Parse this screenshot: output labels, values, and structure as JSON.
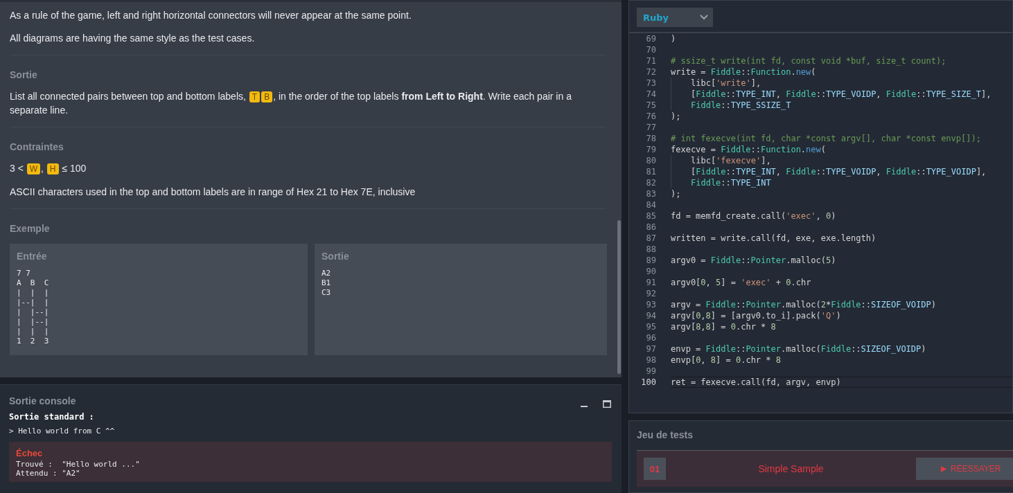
{
  "statement": {
    "intro": [
      [
        {
          "kind": "text",
          "text": "As a rule of the game, left and right horizontal connectors will never appear at the same point."
        }
      ],
      [
        {
          "kind": "text",
          "text": "All diagrams are having the same style as the test cases."
        }
      ]
    ],
    "sections": [
      {
        "heading": "Sortie",
        "paragraphs": [
          [
            {
              "kind": "text",
              "text": "List all connected pairs between top and bottom labels, "
            },
            {
              "kind": "var",
              "text": "T"
            },
            {
              "kind": "var",
              "text": "B"
            },
            {
              "kind": "text",
              "text": ", in the order of the top labels **from Left to Right**. Write each pair in a separate line."
            }
          ]
        ]
      },
      {
        "heading": "Contraintes",
        "paragraphs": [
          [
            {
              "kind": "text",
              "text": "3 < "
            },
            {
              "kind": "var",
              "text": "W"
            },
            {
              "kind": "text",
              "text": ", "
            },
            {
              "kind": "var",
              "text": "H"
            },
            {
              "kind": "text",
              "text": " ≤ 100"
            }
          ],
          [
            {
              "kind": "text",
              "text": "ASCII characters used in the top and bottom labels are in range of Hex 21 to Hex 7E, inclusive"
            }
          ]
        ]
      },
      {
        "heading": "Exemple",
        "example": {
          "input": {
            "heading": "Entrée",
            "lines": [
              "7 7",
              "A  B  C",
              "|  |  |",
              "|--|  |",
              "|  |--|",
              "|  |--|",
              "|  |  |",
              "1  2  3"
            ]
          },
          "output": {
            "heading": "Sortie",
            "lines": [
              "A2",
              "B1",
              "C3"
            ]
          }
        }
      }
    ]
  },
  "console": {
    "title": "Sortie console",
    "stdout_label": "Sortie standard :",
    "stdout_lines": [
      "> Hello world from C ^^"
    ],
    "failure": {
      "title": "Échec",
      "lines": [
        "Trouvé :  \"Hello world ...\"",
        "Attendu : \"A2\""
      ]
    }
  },
  "editor": {
    "language": "Ruby",
    "lines": [
      {
        "n": "69",
        "current": false,
        "indented": false,
        "tokens": [
          {
            "kind": "plain",
            "text": ")"
          }
        ]
      },
      {
        "n": "70",
        "current": false
      },
      {
        "n": "71",
        "current": false,
        "indented": false,
        "tokens": [
          {
            "kind": "comment",
            "text": "# ssize_t write(int fd, const void *buf, size_t count);"
          }
        ]
      },
      {
        "n": "72",
        "current": false,
        "indented": false,
        "tokens": [
          {
            "kind": "plain",
            "text": "write = "
          },
          {
            "kind": "class",
            "text": "Fiddle"
          },
          {
            "kind": "plain",
            "text": "::"
          },
          {
            "kind": "class",
            "text": "Function"
          },
          {
            "kind": "plain",
            "text": "."
          },
          {
            "kind": "method",
            "text": "new"
          },
          {
            "kind": "plain",
            "text": "("
          }
        ]
      },
      {
        "n": "73",
        "current": false,
        "indented": true,
        "tokens": [
          {
            "kind": "plain",
            "text": "libc["
          },
          {
            "kind": "string",
            "text": "'write'"
          },
          {
            "kind": "plain",
            "text": "],"
          }
        ]
      },
      {
        "n": "74",
        "current": false,
        "indented": true,
        "tokens": [
          {
            "kind": "plain",
            "text": "["
          },
          {
            "kind": "class",
            "text": "Fiddle"
          },
          {
            "kind": "plain",
            "text": "::"
          },
          {
            "kind": "constant",
            "text": "TYPE_INT"
          },
          {
            "kind": "plain",
            "text": ", "
          },
          {
            "kind": "class",
            "text": "Fiddle"
          },
          {
            "kind": "plain",
            "text": "::"
          },
          {
            "kind": "constant",
            "text": "TYPE_VOIDP"
          },
          {
            "kind": "plain",
            "text": ", "
          },
          {
            "kind": "class",
            "text": "Fiddle"
          },
          {
            "kind": "plain",
            "text": "::"
          },
          {
            "kind": "constant",
            "text": "TYPE_SIZE_T"
          },
          {
            "kind": "plain",
            "text": "],"
          }
        ]
      },
      {
        "n": "75",
        "current": false,
        "indented": true,
        "tokens": [
          {
            "kind": "class",
            "text": "Fiddle"
          },
          {
            "kind": "plain",
            "text": "::"
          },
          {
            "kind": "constant",
            "text": "TYPE_SSIZE_T"
          }
        ]
      },
      {
        "n": "76",
        "current": false,
        "indented": false,
        "tokens": [
          {
            "kind": "plain",
            "text": ");"
          }
        ]
      },
      {
        "n": "77",
        "current": false
      },
      {
        "n": "78",
        "current": false,
        "indented": false,
        "tokens": [
          {
            "kind": "comment",
            "text": "# int fexecve(int fd, char *const argv[], char *const envp[]);"
          }
        ]
      },
      {
        "n": "79",
        "current": false,
        "indented": false,
        "tokens": [
          {
            "kind": "plain",
            "text": "fexecve = "
          },
          {
            "kind": "class",
            "text": "Fiddle"
          },
          {
            "kind": "plain",
            "text": "::"
          },
          {
            "kind": "class",
            "text": "Function"
          },
          {
            "kind": "plain",
            "text": "."
          },
          {
            "kind": "method",
            "text": "new"
          },
          {
            "kind": "plain",
            "text": "("
          }
        ]
      },
      {
        "n": "80",
        "current": false,
        "indented": true,
        "tokens": [
          {
            "kind": "plain",
            "text": "libc["
          },
          {
            "kind": "string",
            "text": "'fexecve'"
          },
          {
            "kind": "plain",
            "text": "],"
          }
        ]
      },
      {
        "n": "81",
        "current": false,
        "indented": true,
        "tokens": [
          {
            "kind": "plain",
            "text": "["
          },
          {
            "kind": "class",
            "text": "Fiddle"
          },
          {
            "kind": "plain",
            "text": "::"
          },
          {
            "kind": "constant",
            "text": "TYPE_INT"
          },
          {
            "kind": "plain",
            "text": ", "
          },
          {
            "kind": "class",
            "text": "Fiddle"
          },
          {
            "kind": "plain",
            "text": "::"
          },
          {
            "kind": "constant",
            "text": "TYPE_VOIDP"
          },
          {
            "kind": "plain",
            "text": ", "
          },
          {
            "kind": "class",
            "text": "Fiddle"
          },
          {
            "kind": "plain",
            "text": "::"
          },
          {
            "kind": "constant",
            "text": "TYPE_VOIDP"
          },
          {
            "kind": "plain",
            "text": "],"
          }
        ]
      },
      {
        "n": "82",
        "current": false,
        "indented": true,
        "tokens": [
          {
            "kind": "class",
            "text": "Fiddle"
          },
          {
            "kind": "plain",
            "text": "::"
          },
          {
            "kind": "constant",
            "text": "TYPE_INT"
          }
        ]
      },
      {
        "n": "83",
        "current": false,
        "indented": false,
        "tokens": [
          {
            "kind": "plain",
            "text": ");"
          }
        ]
      },
      {
        "n": "84",
        "current": false
      },
      {
        "n": "85",
        "current": false,
        "indented": false,
        "tokens": [
          {
            "kind": "plain",
            "text": "fd = memfd_create.call("
          },
          {
            "kind": "string",
            "text": "'exec'"
          },
          {
            "kind": "plain",
            "text": ", "
          },
          {
            "kind": "number",
            "text": "0"
          },
          {
            "kind": "plain",
            "text": ")"
          }
        ]
      },
      {
        "n": "86",
        "current": false
      },
      {
        "n": "87",
        "current": false,
        "indented": false,
        "tokens": [
          {
            "kind": "plain",
            "text": "written = write.call(fd, exe, exe.length)"
          }
        ]
      },
      {
        "n": "88",
        "current": false
      },
      {
        "n": "89",
        "current": false,
        "indented": false,
        "tokens": [
          {
            "kind": "plain",
            "text": "argv0 = "
          },
          {
            "kind": "class",
            "text": "Fiddle"
          },
          {
            "kind": "plain",
            "text": "::"
          },
          {
            "kind": "class",
            "text": "Pointer"
          },
          {
            "kind": "plain",
            "text": ".malloc("
          },
          {
            "kind": "number",
            "text": "5"
          },
          {
            "kind": "plain",
            "text": ")"
          }
        ]
      },
      {
        "n": "90",
        "current": false
      },
      {
        "n": "91",
        "current": false,
        "indented": false,
        "tokens": [
          {
            "kind": "plain",
            "text": "argv0["
          },
          {
            "kind": "number",
            "text": "0"
          },
          {
            "kind": "plain",
            "text": ", "
          },
          {
            "kind": "number",
            "text": "5"
          },
          {
            "kind": "plain",
            "text": "] = "
          },
          {
            "kind": "string",
            "text": "'exec'"
          },
          {
            "kind": "plain",
            "text": " + "
          },
          {
            "kind": "number",
            "text": "0"
          },
          {
            "kind": "plain",
            "text": ".chr"
          }
        ]
      },
      {
        "n": "92",
        "current": false
      },
      {
        "n": "93",
        "current": false,
        "indented": false,
        "tokens": [
          {
            "kind": "plain",
            "text": "argv = "
          },
          {
            "kind": "class",
            "text": "Fiddle"
          },
          {
            "kind": "plain",
            "text": "::"
          },
          {
            "kind": "class",
            "text": "Pointer"
          },
          {
            "kind": "plain",
            "text": ".malloc("
          },
          {
            "kind": "number",
            "text": "2"
          },
          {
            "kind": "plain",
            "text": "*"
          },
          {
            "kind": "class",
            "text": "Fiddle"
          },
          {
            "kind": "plain",
            "text": "::"
          },
          {
            "kind": "constant",
            "text": "SIZEOF_VOIDP"
          },
          {
            "kind": "plain",
            "text": ")"
          }
        ]
      },
      {
        "n": "94",
        "current": false,
        "indented": false,
        "tokens": [
          {
            "kind": "plain",
            "text": "argv["
          },
          {
            "kind": "number",
            "text": "0"
          },
          {
            "kind": "plain",
            "text": ","
          },
          {
            "kind": "number",
            "text": "8"
          },
          {
            "kind": "plain",
            "text": "] = [argv0.to_i].pack("
          },
          {
            "kind": "string",
            "text": "'Q'"
          },
          {
            "kind": "plain",
            "text": ")"
          }
        ]
      },
      {
        "n": "95",
        "current": false,
        "indented": false,
        "tokens": [
          {
            "kind": "plain",
            "text": "argv["
          },
          {
            "kind": "number",
            "text": "8"
          },
          {
            "kind": "plain",
            "text": ","
          },
          {
            "kind": "number",
            "text": "8"
          },
          {
            "kind": "plain",
            "text": "] = "
          },
          {
            "kind": "number",
            "text": "0"
          },
          {
            "kind": "plain",
            "text": ".chr * "
          },
          {
            "kind": "number",
            "text": "8"
          }
        ]
      },
      {
        "n": "96",
        "current": false
      },
      {
        "n": "97",
        "current": false,
        "indented": false,
        "tokens": [
          {
            "kind": "plain",
            "text": "envp = "
          },
          {
            "kind": "class",
            "text": "Fiddle"
          },
          {
            "kind": "plain",
            "text": "::"
          },
          {
            "kind": "class",
            "text": "Pointer"
          },
          {
            "kind": "plain",
            "text": ".malloc("
          },
          {
            "kind": "class",
            "text": "Fiddle"
          },
          {
            "kind": "plain",
            "text": "::"
          },
          {
            "kind": "constant",
            "text": "SIZEOF_VOIDP"
          },
          {
            "kind": "plain",
            "text": ")"
          }
        ]
      },
      {
        "n": "98",
        "current": false,
        "indented": false,
        "tokens": [
          {
            "kind": "plain",
            "text": "envp["
          },
          {
            "kind": "number",
            "text": "0"
          },
          {
            "kind": "plain",
            "text": ", "
          },
          {
            "kind": "number",
            "text": "8"
          },
          {
            "kind": "plain",
            "text": "] = "
          },
          {
            "kind": "number",
            "text": "0"
          },
          {
            "kind": "plain",
            "text": ".chr * "
          },
          {
            "kind": "number",
            "text": "8"
          }
        ]
      },
      {
        "n": "99",
        "current": false
      },
      {
        "n": "100",
        "current": true,
        "indented": false,
        "tokens": [
          {
            "kind": "plain",
            "text": "ret = fexecve.call(fd, argv, envp)"
          }
        ]
      }
    ]
  },
  "tests": {
    "title": "Jeu de tests",
    "cases": [
      {
        "number": "01",
        "name": "Simple Sample",
        "failed": true,
        "action": "RÉESSAYER"
      }
    ]
  }
}
